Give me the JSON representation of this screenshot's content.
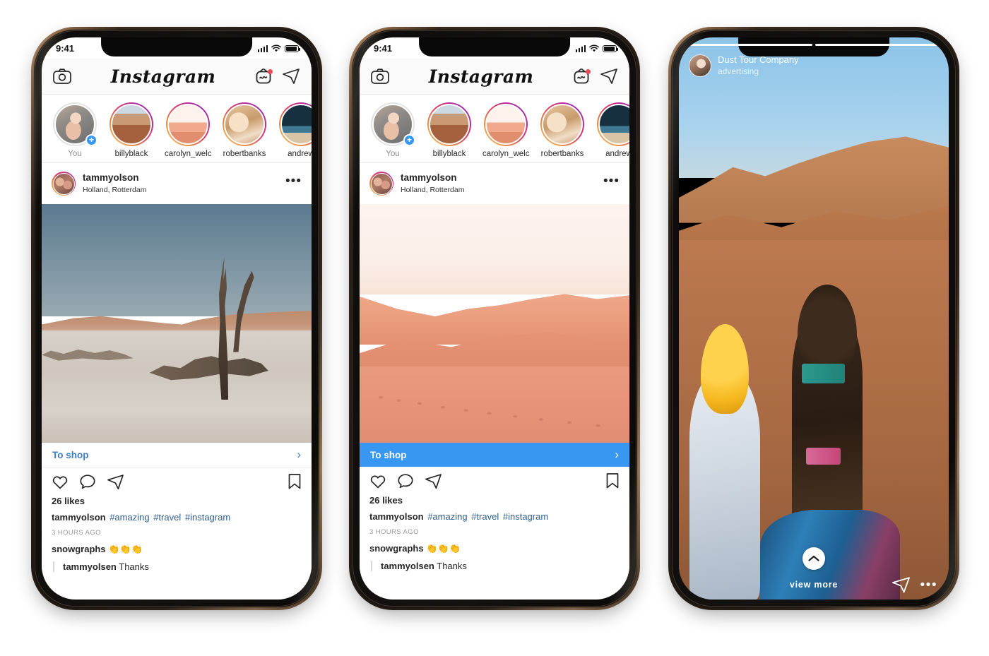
{
  "page": {
    "background": "#ffffff",
    "accent_blue": "#3897f0",
    "link_blue": "#3b7fc4",
    "tag_blue": "#2f5e8e"
  },
  "status_bar": {
    "time": "9:41",
    "signal_icon": "cellular-bars-icon",
    "wifi_icon": "wifi-icon",
    "battery_icon": "battery-icon"
  },
  "nav": {
    "camera_icon": "camera-icon",
    "logo": "Instagram",
    "igtv_icon": "igtv-icon",
    "direct_icon": "paper-plane-icon"
  },
  "stories": [
    {
      "name": "You",
      "has_ring": false,
      "has_plus": true,
      "art": "av-you"
    },
    {
      "name": "billyblack",
      "has_ring": true,
      "has_plus": false,
      "art": "av-billy"
    },
    {
      "name": "carolyn_welch",
      "has_ring": true,
      "has_plus": false,
      "art": "av-carolyn"
    },
    {
      "name": "robertbanks",
      "has_ring": true,
      "has_plus": false,
      "art": "av-robert"
    },
    {
      "name": "andrew",
      "has_ring": true,
      "has_plus": false,
      "art": "av-andrew"
    }
  ],
  "post": {
    "username": "tammyolson",
    "location": "Holland, Rotterdam",
    "more_icon": "more-options-icon",
    "to_shop_label": "To shop",
    "to_shop_chevron": "chevron-right-icon",
    "like_icon": "heart-icon",
    "comment_icon": "comment-bubble-icon",
    "share_icon": "paper-plane-icon",
    "save_icon": "bookmark-icon",
    "likes": "26 likes",
    "caption_user": "tammyolson",
    "caption_tags": [
      "#amazing",
      "#travel",
      "#instagram"
    ],
    "timestamp": "3 HOURS AGO",
    "comment_user": "snowgraphs",
    "comment_text": "👏👏👏",
    "reply_user": "tammyolsen",
    "reply_text": "Thanks"
  },
  "phones": [
    {
      "id": "phone-feed-plain",
      "photo": "dead-tree-salt-pan",
      "to_shop_style": "light"
    },
    {
      "id": "phone-feed-highlighted",
      "photo": "pink-sand-dunes",
      "to_shop_style": "blue"
    }
  ],
  "story_view": {
    "progress_segments": 2,
    "active_segment": 1,
    "avatar": "story-author-avatar",
    "title": "Dust Tour Company",
    "subtitle": "advertising",
    "up_chevron_icon": "chevron-up-icon",
    "view_more_label": "view more",
    "share_icon": "paper-plane-icon",
    "more_icon": "more-options-icon",
    "photo": "camel-rider-desert"
  }
}
